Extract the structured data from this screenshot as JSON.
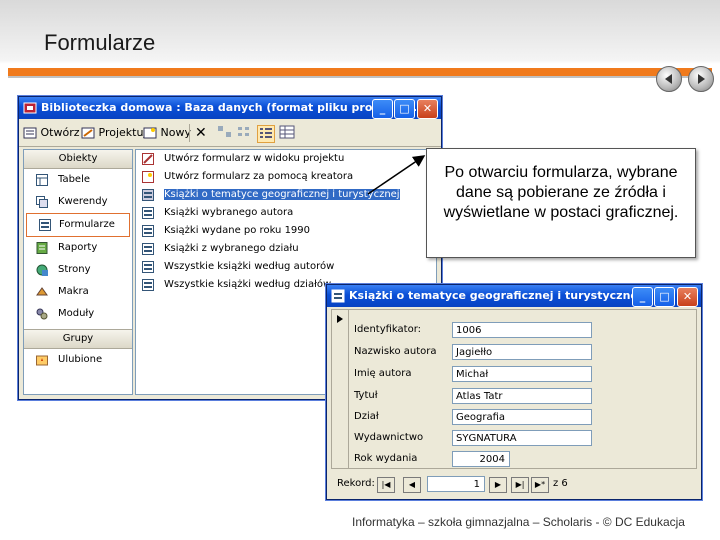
{
  "slide": {
    "title": "Formularze",
    "footer": "Informatyka – szkoła gimnazjalna – Scholaris - © DC Edukacja"
  },
  "db_window": {
    "title": "Biblioteczka domowa : Baza danych (format pliku program...",
    "toolbar": {
      "open": "Otwórz",
      "design": "Projektuj",
      "new": "Nowy"
    },
    "objects_header": "Obiekty",
    "objects": [
      {
        "label": "Tabele",
        "icon": "table-icon"
      },
      {
        "label": "Kwerendy",
        "icon": "query-icon"
      },
      {
        "label": "Formularze",
        "icon": "form-icon",
        "selected": true
      },
      {
        "label": "Raporty",
        "icon": "report-icon"
      },
      {
        "label": "Strony",
        "icon": "page-icon"
      },
      {
        "label": "Makra",
        "icon": "macro-icon"
      },
      {
        "label": "Moduły",
        "icon": "module-icon"
      }
    ],
    "groups_header": "Grupy",
    "groups": [
      {
        "label": "Ulubione",
        "icon": "favorites-icon"
      }
    ],
    "items": [
      {
        "label": "Utwórz formularz w widoku projektu",
        "icon": "wizard-icon"
      },
      {
        "label": "Utwórz formularz za pomocą kreatora",
        "icon": "wizard-icon"
      },
      {
        "label": "Książki o tematyce geograficznej i turystycznej",
        "icon": "form-icon",
        "selected": true
      },
      {
        "label": "Książki wybranego autora",
        "icon": "form-icon"
      },
      {
        "label": "Książki wydane po roku 1990",
        "icon": "form-icon"
      },
      {
        "label": "Książki z wybranego działu",
        "icon": "form-icon"
      },
      {
        "label": "Wszystkie książki według autorów",
        "icon": "form-icon"
      },
      {
        "label": "Wszystkie książki według działów",
        "icon": "form-icon"
      }
    ]
  },
  "callout": {
    "text": "Po otwarciu formularza, wybrane dane są pobierane ze źródła i wyświetlane w postaci graficznej."
  },
  "form_window": {
    "title": "Książki o tematyce geograficznej i turystycznej",
    "fields": [
      {
        "label": "Identyfikator:",
        "value": "1006"
      },
      {
        "label": "Nazwisko autora",
        "value": "Jagiełło"
      },
      {
        "label": "Imię autora",
        "value": "Michał"
      },
      {
        "label": "Tytuł",
        "value": "Atlas Tatr"
      },
      {
        "label": "Dział",
        "value": "Geografia"
      },
      {
        "label": "Wydawnictwo",
        "value": "SYGNATURA"
      },
      {
        "label": "Rok wydania",
        "value": "2004"
      }
    ],
    "nav": {
      "label": "Rekord:",
      "current": "1",
      "of_total": "z 6"
    }
  },
  "colors": {
    "accent": "#f07a1c",
    "titlebar": "#0a4fd6",
    "selection": "#316ac5"
  }
}
